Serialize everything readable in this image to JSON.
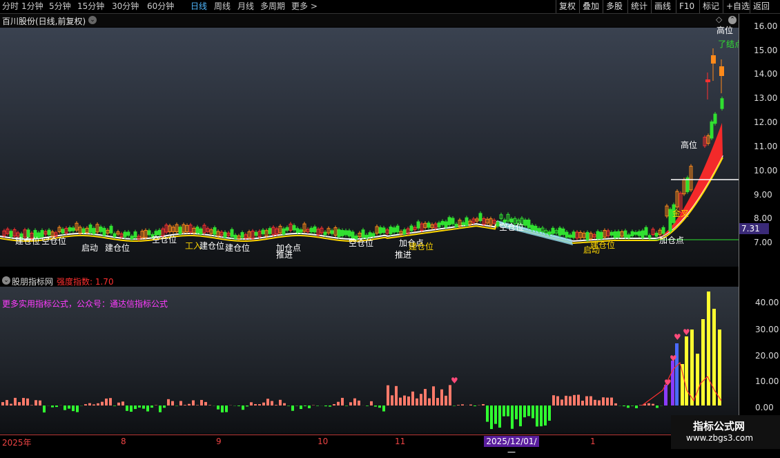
{
  "toolbar": {
    "periods": [
      "分时",
      "1分钟",
      "5分钟",
      "15分钟",
      "30分钟",
      "60分钟",
      "日线",
      "周线",
      "月线",
      "多周期",
      "更多 >"
    ],
    "active_period": "日线",
    "tools": [
      "复权",
      "叠加",
      "多股",
      "统计",
      "画线",
      "F10",
      "标记",
      "+自选",
      "返回"
    ]
  },
  "main": {
    "title": "百川股份(日线,前复权)",
    "price_axis": [
      "16.00",
      "15.00",
      "14.00",
      "13.00",
      "12.00",
      "11.00",
      "10.00",
      "9.00",
      "8.00",
      "7.00"
    ],
    "current_price": "7.31",
    "signals": [
      {
        "text": "建仓位",
        "color": "#ffffff"
      },
      {
        "text": "空仓位",
        "color": "#ffffff"
      },
      {
        "text": "启动",
        "color": "#ffffff"
      },
      {
        "text": "建仓位",
        "color": "#ffffff"
      },
      {
        "text": "空仓位",
        "color": "#ffffff"
      },
      {
        "text": "工入",
        "color": "#ffd700"
      },
      {
        "text": "建仓位",
        "color": "#ffffff"
      },
      {
        "text": "建仓位",
        "color": "#ffffff"
      },
      {
        "text": "加仓点",
        "color": "#ffffff"
      },
      {
        "text": "推进",
        "color": "#ffffff"
      },
      {
        "text": "空仓位",
        "color": "#ffffff"
      },
      {
        "text": "加仓点",
        "color": "#ffffff"
      },
      {
        "text": "建仓位",
        "color": "#ffd700"
      },
      {
        "text": "推进",
        "color": "#ffffff"
      },
      {
        "text": "空仓位",
        "color": "#ffffff"
      },
      {
        "text": "建仓位",
        "color": "#ffd700"
      },
      {
        "text": "启动",
        "color": "#ffd700"
      },
      {
        "text": "加仓点",
        "color": "#ffffff"
      },
      {
        "text": "金叉",
        "color": "#ffd700"
      },
      {
        "text": "高位",
        "color": "#ffffff"
      },
      {
        "text": "了结点",
        "color": "#30e030"
      },
      {
        "text": "高位",
        "color": "#ffffff"
      }
    ]
  },
  "indicator": {
    "name": "股朋指标网",
    "value_label": "强度指数: 1.70",
    "promo": "更多实用指标公式，公众号：通达信指标公式",
    "axis": [
      "40.00",
      "30.00",
      "20.00",
      "10.00",
      "0.00"
    ]
  },
  "dates": [
    "2025年",
    "8",
    "9",
    "10",
    "11",
    "2025/12/01/一",
    "1"
  ],
  "watermark": {
    "line1": "指标公式网",
    "line2": "www.zbgs3.com"
  },
  "colors": {
    "up": "#ff3030",
    "down": "#30e030",
    "active_period": "#4fb8ff",
    "promo": "#ff3cff",
    "price_box": "#3a2a78"
  },
  "icons": [
    "dropdown-circle-icon",
    "diamond-icon",
    "expand-circle-icon"
  ]
}
